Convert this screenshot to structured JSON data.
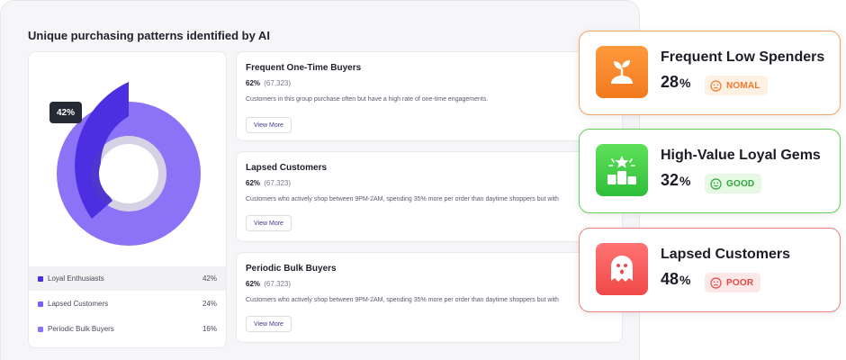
{
  "panel": {
    "title": "Unique purchasing patterns identified by AI"
  },
  "chart": {
    "tooltip": "42%",
    "legend": [
      {
        "label": "Loyal Enthusiasts",
        "value": "42%",
        "color": "#4c2fe0"
      },
      {
        "label": "Lapsed Customers",
        "value": "24%",
        "color": "#7a5ef2"
      },
      {
        "label": "Periodic Bulk Buyers",
        "value": "16%",
        "color": "#8c72f7"
      }
    ]
  },
  "segments": [
    {
      "title": "Frequent One-Time Buyers",
      "pct": "62%",
      "count": "(67,323)",
      "description": "Customers in this group purchase often but have a high rate of one-time engagements.",
      "button": "View More"
    },
    {
      "title": "Lapsed Customers",
      "pct": "62%",
      "count": "(67,323)",
      "description": "Customers who actively shop between 9PM-2AM, spending 35% more per order than daytime shoppers but with",
      "button": "View More"
    },
    {
      "title": "Periodic Bulk Buyers",
      "pct": "62%",
      "count": "(67,323)",
      "description": "Customers who actively shop between 9PM-2AM, spending 35% more per order than daytime shoppers but with",
      "button": "View More"
    }
  ],
  "badges": [
    {
      "name": "Frequent Low Spenders",
      "value": "28",
      "unit": "%",
      "status": "NOMAL",
      "icon": "sprout-icon",
      "border": "#f2a565",
      "status_color": "#ef7a2c",
      "status_bg": "#fff0e4"
    },
    {
      "name": "High-Value Loyal Gems",
      "value": "32",
      "unit": "%",
      "status": "GOOD",
      "icon": "podium-star-icon",
      "border": "#63cf58",
      "status_color": "#31a73a",
      "status_bg": "#e7f8e5"
    },
    {
      "name": "Lapsed Customers",
      "value": "48",
      "unit": "%",
      "status": "POOR",
      "icon": "ghost-icon",
      "border": "#f08080",
      "status_color": "#e04848",
      "status_bg": "#fde8e8"
    }
  ]
}
